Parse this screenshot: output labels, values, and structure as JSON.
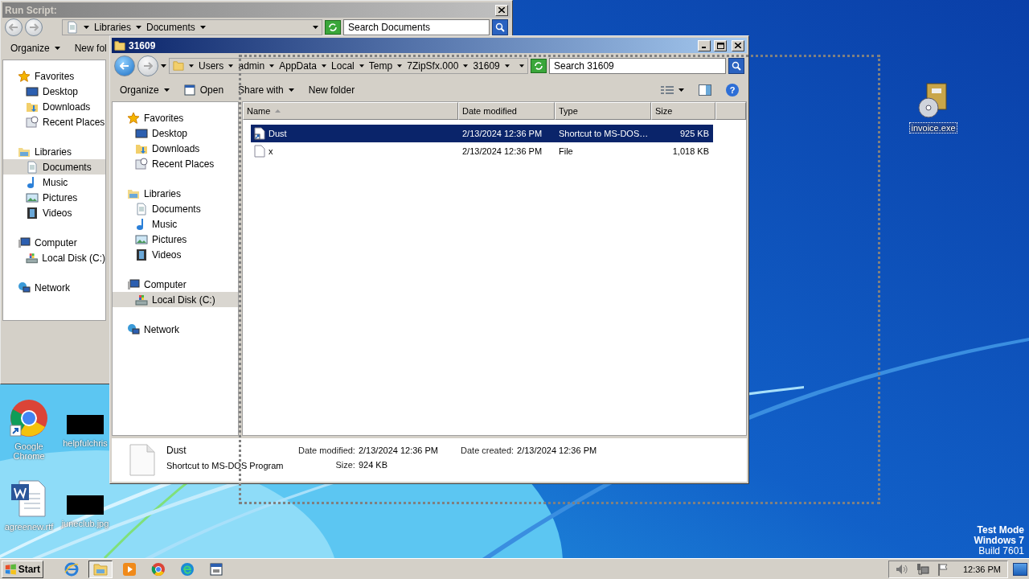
{
  "back_window": {
    "title": "Run Script:",
    "address": [
      "Libraries",
      "Documents"
    ],
    "search": {
      "placeholder": "Search Documents"
    },
    "toolbar": [
      {
        "label": "Organize",
        "kind": "menu"
      },
      {
        "label": "New fol",
        "kind": "plain"
      }
    ],
    "nav": [
      {
        "label": "Favorites",
        "kind": "star",
        "selected": false,
        "children": [
          {
            "label": "Desktop",
            "kind": "desktop",
            "selected": false
          },
          {
            "label": "Downloads",
            "kind": "downloads",
            "selected": false
          },
          {
            "label": "Recent Places",
            "kind": "recent",
            "selected": false
          }
        ]
      },
      {
        "label": "Libraries",
        "kind": "libraries",
        "selected": false,
        "children": [
          {
            "label": "Documents",
            "kind": "documents",
            "selected": true
          },
          {
            "label": "Music",
            "kind": "music",
            "selected": false
          },
          {
            "label": "Pictures",
            "kind": "pictures",
            "selected": false
          },
          {
            "label": "Videos",
            "kind": "videos",
            "selected": false
          }
        ]
      },
      {
        "label": "Computer",
        "kind": "computer",
        "selected": false,
        "children": [
          {
            "label": "Local Disk (C:)",
            "kind": "disk",
            "selected": false
          }
        ]
      },
      {
        "label": "Network",
        "kind": "network",
        "selected": false
      }
    ]
  },
  "front_window": {
    "title": "31609",
    "address": [
      "Users",
      "admin",
      "AppData",
      "Local",
      "Temp",
      "7ZipSfx.000",
      "31609"
    ],
    "search": {
      "placeholder": "Search 31609"
    },
    "toolbar": [
      {
        "label": "Organize",
        "kind": "menu"
      },
      {
        "label": "Open",
        "kind": "open"
      },
      {
        "label": "Share with",
        "kind": "menu"
      },
      {
        "label": "New folder",
        "kind": "plain"
      }
    ],
    "help": "?",
    "nav": [
      {
        "label": "Favorites",
        "kind": "star",
        "selected": false,
        "children": [
          {
            "label": "Desktop",
            "kind": "desktop",
            "selected": false
          },
          {
            "label": "Downloads",
            "kind": "downloads",
            "selected": false
          },
          {
            "label": "Recent Places",
            "kind": "recent",
            "selected": false
          }
        ]
      },
      {
        "label": "Libraries",
        "kind": "libraries",
        "selected": false,
        "children": [
          {
            "label": "Documents",
            "kind": "documents",
            "selected": false
          },
          {
            "label": "Music",
            "kind": "music",
            "selected": false
          },
          {
            "label": "Pictures",
            "kind": "pictures",
            "selected": false
          },
          {
            "label": "Videos",
            "kind": "videos",
            "selected": false
          }
        ]
      },
      {
        "label": "Computer",
        "kind": "computer",
        "selected": false,
        "children": [
          {
            "label": "Local Disk (C:)",
            "kind": "disk",
            "selected": true
          }
        ]
      },
      {
        "label": "Network",
        "kind": "network",
        "selected": false
      }
    ],
    "columns": [
      {
        "label": "Name",
        "sorted": true
      },
      {
        "label": "Date modified",
        "sorted": false
      },
      {
        "label": "Type",
        "sorted": false
      },
      {
        "label": "Size",
        "sorted": false
      }
    ],
    "rows": [
      {
        "name": "Dust",
        "kind": "shortcut",
        "date_modified": "2/13/2024 12:36 PM",
        "type": "Shortcut to MS-DOS…",
        "size": "925 KB",
        "selected": true
      },
      {
        "name": "x",
        "kind": "file",
        "date_modified": "2/13/2024 12:36 PM",
        "type": "File",
        "size": "1,018 KB",
        "selected": false
      }
    ],
    "details": {
      "name": "Dust",
      "type": "Shortcut to MS-DOS Program",
      "columns": [
        [
          {
            "label": "Date modified:",
            "value": "2/13/2024 12:36 PM"
          },
          {
            "label": "Size:",
            "value": "924 KB"
          }
        ],
        [
          {
            "label": "Date created:",
            "value": "2/13/2024 12:36 PM"
          }
        ]
      ]
    }
  },
  "desktop_icons": [
    {
      "label": "invoice.exe",
      "kind": "installer",
      "selected": true
    },
    {
      "label": "Google Chrome",
      "kind": "chrome",
      "selected": false
    },
    {
      "label": "helpfulchris",
      "kind": "thumbnail",
      "selected": false
    },
    {
      "label": "agreenew.rtf",
      "kind": "word",
      "selected": false
    },
    {
      "label": "juneclub.jpg",
      "kind": "thumbnail",
      "selected": false
    }
  ],
  "system_notice": [
    "Test Mode",
    "Windows 7",
    "Build 7601"
  ],
  "taskbar": {
    "start": "Start",
    "apps": [
      {
        "kind": "ie",
        "active": false
      },
      {
        "kind": "explorer",
        "active": true
      },
      {
        "kind": "media",
        "active": false
      },
      {
        "kind": "chrome",
        "active": false
      },
      {
        "kind": "edge",
        "active": false
      },
      {
        "kind": "app",
        "active": false
      }
    ],
    "clock": "12:36 PM"
  }
}
